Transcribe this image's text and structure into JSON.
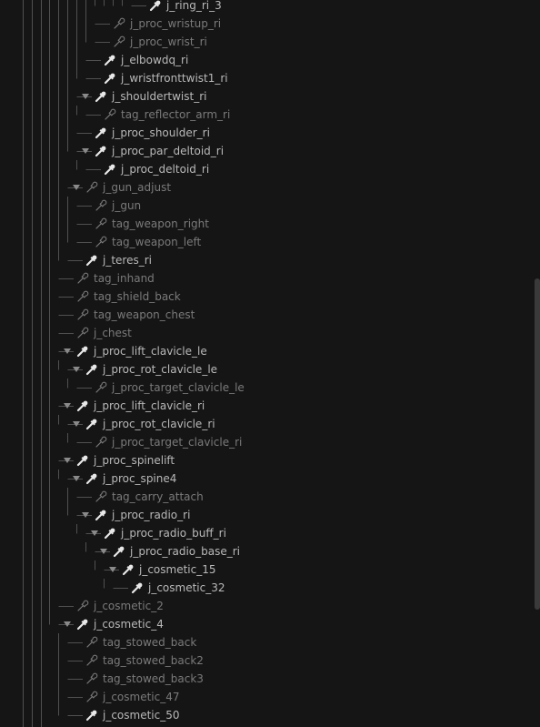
{
  "tree": {
    "rows": [
      {
        "label": "j_ring_ri_3",
        "depth": 9,
        "expanded": false,
        "ghost": false
      },
      {
        "label": "j_proc_wristup_ri",
        "depth": 5,
        "expanded": false,
        "ghost": true
      },
      {
        "label": "j_proc_wrist_ri",
        "depth": 5,
        "expanded": false,
        "ghost": true
      },
      {
        "label": "j_elbowdq_ri",
        "depth": 4,
        "expanded": false,
        "ghost": false
      },
      {
        "label": "j_wristfronttwist1_ri",
        "depth": 4,
        "expanded": false,
        "ghost": false
      },
      {
        "label": "j_shouldertwist_ri",
        "depth": 3,
        "expanded": true,
        "ghost": false
      },
      {
        "label": "tag_reflector_arm_ri",
        "depth": 4,
        "expanded": false,
        "ghost": true
      },
      {
        "label": "j_proc_shoulder_ri",
        "depth": 3,
        "expanded": false,
        "ghost": false
      },
      {
        "label": "j_proc_par_deltoid_ri",
        "depth": 3,
        "expanded": true,
        "ghost": false
      },
      {
        "label": "j_proc_deltoid_ri",
        "depth": 4,
        "expanded": false,
        "ghost": false
      },
      {
        "label": "j_gun_adjust",
        "depth": 2,
        "expanded": true,
        "ghost": true
      },
      {
        "label": "j_gun",
        "depth": 3,
        "expanded": false,
        "ghost": true
      },
      {
        "label": "tag_weapon_right",
        "depth": 3,
        "expanded": false,
        "ghost": true
      },
      {
        "label": "tag_weapon_left",
        "depth": 3,
        "expanded": false,
        "ghost": true
      },
      {
        "label": "j_teres_ri",
        "depth": 2,
        "expanded": false,
        "ghost": false
      },
      {
        "label": "tag_inhand",
        "depth": 1,
        "expanded": false,
        "ghost": true
      },
      {
        "label": "tag_shield_back",
        "depth": 1,
        "expanded": false,
        "ghost": true
      },
      {
        "label": "tag_weapon_chest",
        "depth": 1,
        "expanded": false,
        "ghost": true
      },
      {
        "label": "j_chest",
        "depth": 1,
        "expanded": false,
        "ghost": true
      },
      {
        "label": "j_proc_lift_clavicle_le",
        "depth": 1,
        "expanded": true,
        "ghost": false
      },
      {
        "label": "j_proc_rot_clavicle_le",
        "depth": 2,
        "expanded": true,
        "ghost": false
      },
      {
        "label": "j_proc_target_clavicle_le",
        "depth": 3,
        "expanded": false,
        "ghost": true
      },
      {
        "label": "j_proc_lift_clavicle_ri",
        "depth": 1,
        "expanded": true,
        "ghost": false
      },
      {
        "label": "j_proc_rot_clavicle_ri",
        "depth": 2,
        "expanded": true,
        "ghost": false
      },
      {
        "label": "j_proc_target_clavicle_ri",
        "depth": 3,
        "expanded": false,
        "ghost": true
      },
      {
        "label": "j_proc_spinelift",
        "depth": 1,
        "expanded": true,
        "ghost": false
      },
      {
        "label": "j_proc_spine4",
        "depth": 2,
        "expanded": true,
        "ghost": false
      },
      {
        "label": "tag_carry_attach",
        "depth": 3,
        "expanded": false,
        "ghost": true
      },
      {
        "label": "j_proc_radio_ri",
        "depth": 3,
        "expanded": true,
        "ghost": false
      },
      {
        "label": "j_proc_radio_buff_ri",
        "depth": 4,
        "expanded": true,
        "ghost": false
      },
      {
        "label": "j_proc_radio_base_ri",
        "depth": 5,
        "expanded": true,
        "ghost": false
      },
      {
        "label": "j_cosmetic_15",
        "depth": 6,
        "expanded": true,
        "ghost": false
      },
      {
        "label": "j_cosmetic_32",
        "depth": 7,
        "expanded": false,
        "ghost": false
      },
      {
        "label": "j_cosmetic_2",
        "depth": 1,
        "expanded": false,
        "ghost": true
      },
      {
        "label": "j_cosmetic_4",
        "depth": 1,
        "expanded": true,
        "ghost": false
      },
      {
        "label": "tag_stowed_back",
        "depth": 2,
        "expanded": false,
        "ghost": true
      },
      {
        "label": "tag_stowed_back2",
        "depth": 2,
        "expanded": false,
        "ghost": true
      },
      {
        "label": "tag_stowed_back3",
        "depth": 2,
        "expanded": false,
        "ghost": true
      },
      {
        "label": "j_cosmetic_47",
        "depth": 2,
        "expanded": false,
        "ghost": true
      },
      {
        "label": "j_cosmetic_50",
        "depth": 2,
        "expanded": false,
        "ghost": false
      }
    ],
    "icons": {
      "solid": "bone-icon",
      "ghost": "bone-outline-icon",
      "expander": "triangle-down-icon"
    },
    "colors": {
      "background": "#151515",
      "text": "#b9b9b9",
      "ghost_text": "#7a7a7a",
      "guide": "#505050"
    }
  }
}
